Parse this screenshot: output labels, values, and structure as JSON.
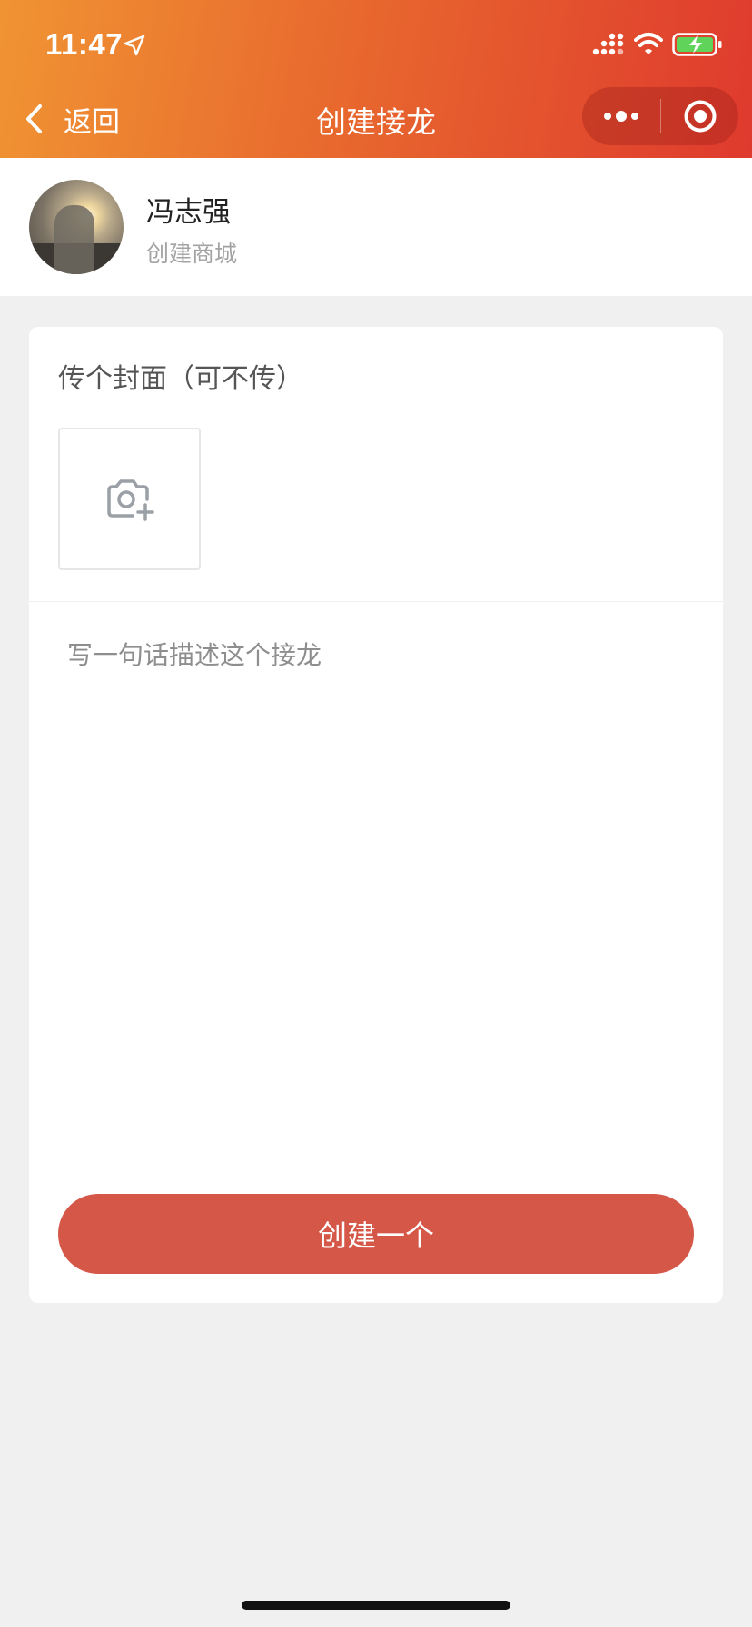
{
  "status_bar": {
    "time": "11:47",
    "icons": [
      "location-arrow-icon",
      "signal-icon",
      "wifi-icon",
      "battery-charging-icon"
    ]
  },
  "nav": {
    "back_label": "返回",
    "title": "创建接龙",
    "capsule_icons": [
      "more-dots-icon",
      "close-circle-icon"
    ]
  },
  "user": {
    "name": "冯志强",
    "subtitle": "创建商城"
  },
  "form": {
    "cover_label": "传个封面（可不传）",
    "upload_icon": "camera-add-icon",
    "description_placeholder": "写一句话描述这个接龙",
    "description_value": "",
    "submit_label": "创建一个"
  },
  "colors": {
    "header_gradient_start": "#f09433",
    "header_gradient_end": "#df3a2e",
    "button": "#d55747",
    "page_background": "#f0f0f0"
  }
}
